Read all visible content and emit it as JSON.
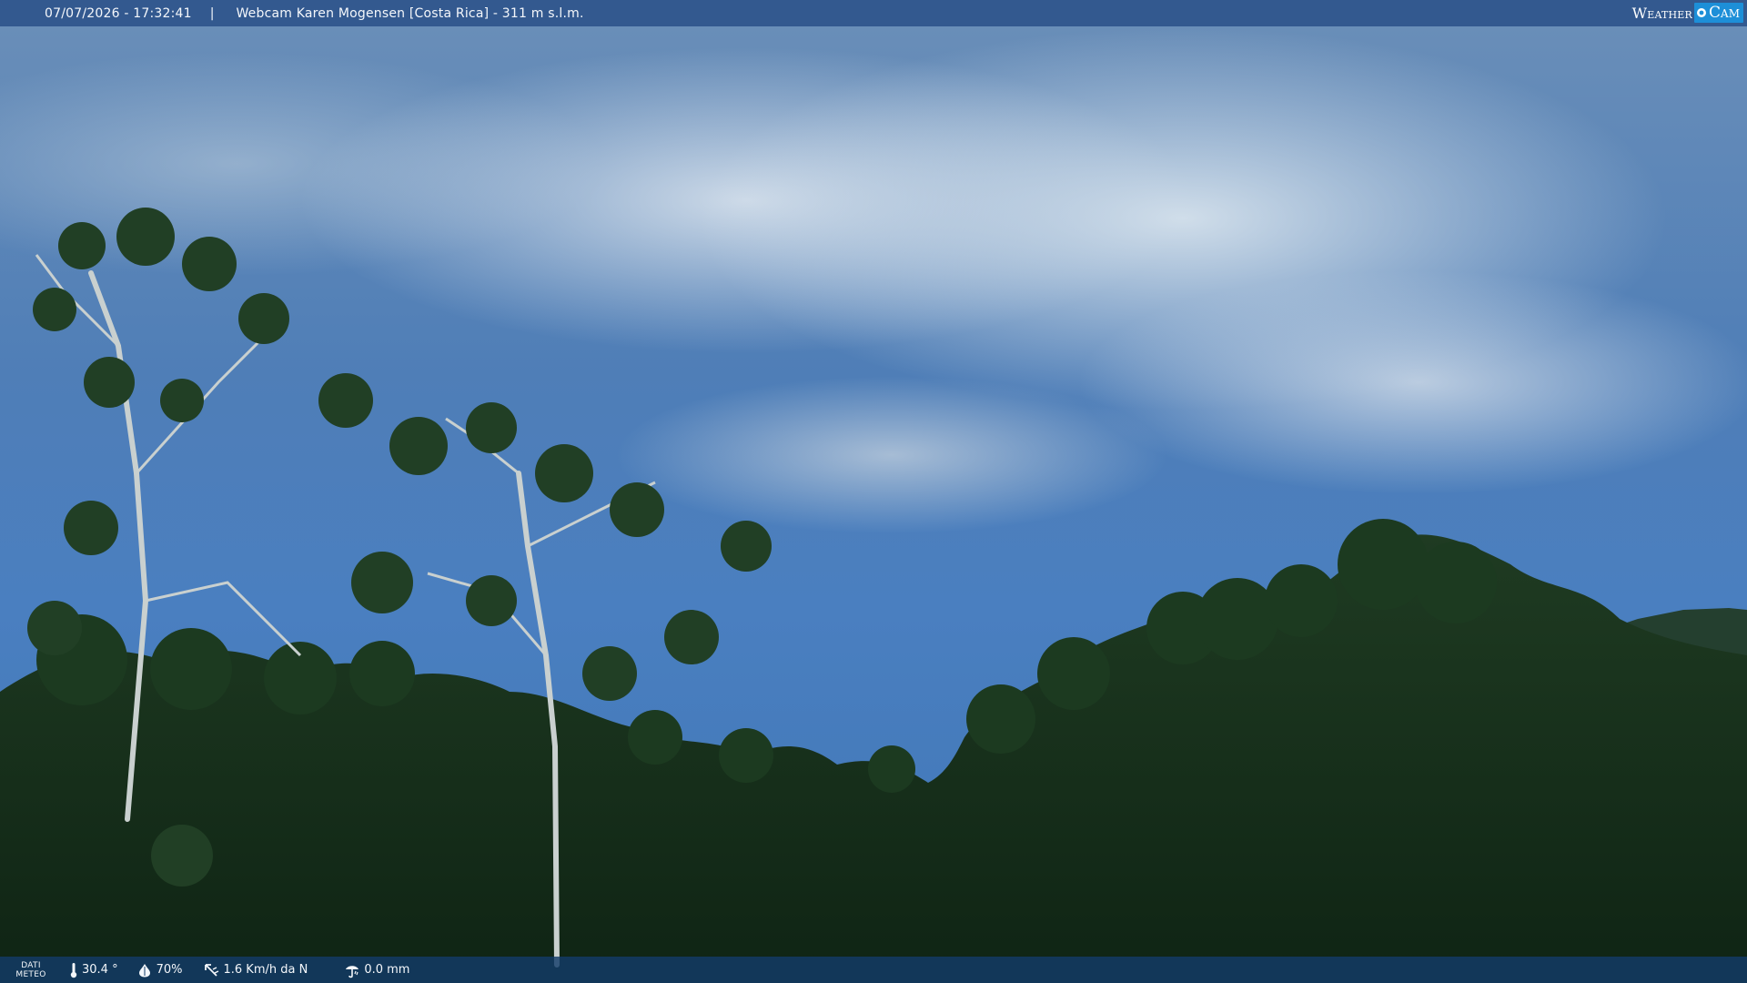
{
  "header": {
    "datetime": "07/07/2026 - 17:32:41",
    "separator": "|",
    "title": "Webcam Karen Mogensen [Costa Rica]  - 311 m s.l.m."
  },
  "brand": {
    "weather_text": "Weather",
    "cam_text": "Cam"
  },
  "footer": {
    "label_line1": "DATI",
    "label_line2": "METEO",
    "temperature": "30.4 °",
    "humidity": "70%",
    "wind": "1.6 Km/h da N",
    "rain": "0.0 mm"
  },
  "colors": {
    "header_bg": "#244a84",
    "footer_bg": "#143c69",
    "brand_accent": "#1d8fd8",
    "text": "#f4f7fb"
  },
  "icons": {
    "temperature": "thermometer-icon",
    "humidity": "drop-icon",
    "wind": "wind-vane-icon",
    "rain": "rain-gauge-icon",
    "brand": "camera-lens-icon"
  }
}
